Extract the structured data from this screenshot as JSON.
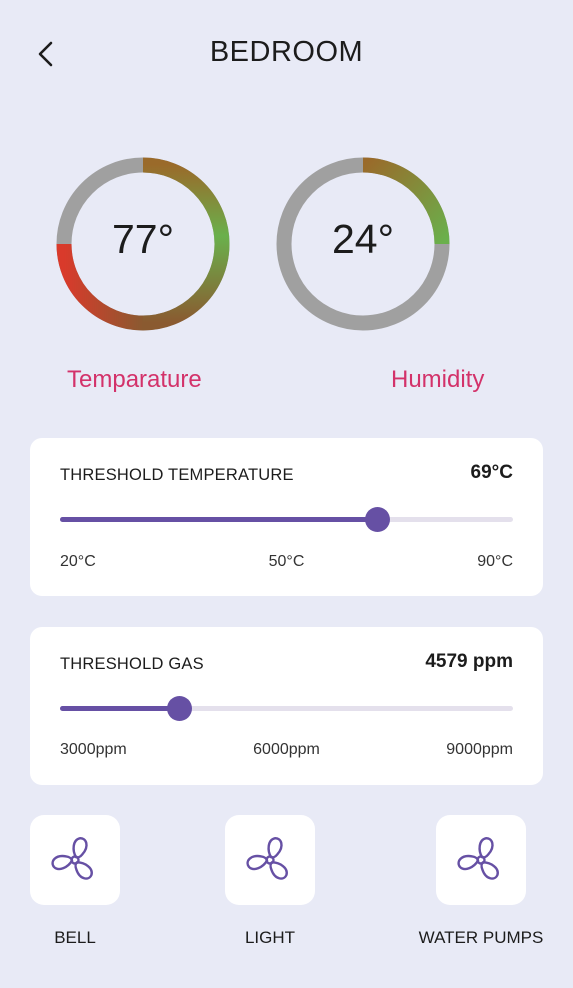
{
  "header": {
    "title": "BEDROOM",
    "back_icon": "chevron-left-icon"
  },
  "gauges": [
    {
      "value_text": "77°",
      "label": "Temparature",
      "level_percent": 78,
      "colors": {
        "track": "#a0a0a0",
        "start": "#9a6a2a",
        "mid": "#6ab04c",
        "end": "#d93a2b"
      }
    },
    {
      "value_text": "24°",
      "label": "Humidity",
      "level_percent": 25,
      "colors": {
        "track": "#a0a0a0",
        "start": "#9a6a2a",
        "end": "#6ab04c"
      }
    }
  ],
  "thresholds": {
    "temperature": {
      "title": "THRESHOLD TEMPERATURE",
      "value": "69°C",
      "min": 20,
      "max": 90,
      "current": 69,
      "ticks": [
        "20°C",
        "50°C",
        "90°C"
      ]
    },
    "gas": {
      "title": "THRESHOLD GAS",
      "value": "4579 ppm",
      "min": 3000,
      "max": 9000,
      "current": 4579,
      "ticks": [
        "3000ppm",
        "6000ppm",
        "9000ppm"
      ]
    }
  },
  "devices": [
    {
      "label": "BELL",
      "icon": "fan-icon"
    },
    {
      "label": "LIGHT",
      "icon": "fan-icon"
    },
    {
      "label": "WATER PUMPS",
      "icon": "fan-icon"
    }
  ],
  "colors": {
    "background": "#e8eaf6",
    "accent": "#6650a4",
    "gauge_label": "#d3326a",
    "card": "#ffffff"
  }
}
